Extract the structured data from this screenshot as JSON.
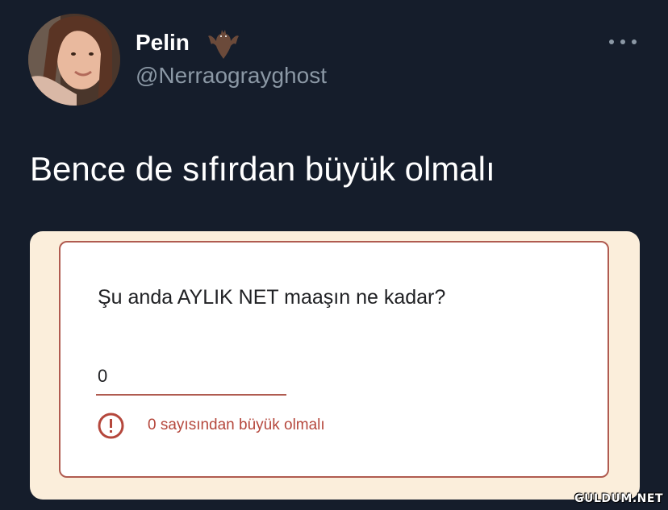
{
  "tweet": {
    "author": {
      "display_name": "Pelin",
      "username": "@Nerraograyghost",
      "avatar_icon": "profile-photo",
      "name_emoji": "bat-icon"
    },
    "more_icon": "more-horizontal-icon",
    "text": "Bence de sıfırdan büyük olmalı"
  },
  "form": {
    "question": "Şu anda AYLIK NET maaşın ne kadar?",
    "answer_value": "0",
    "error_icon": "error-circle-icon",
    "error_message": "0 sayısından büyük olmalı",
    "colors": {
      "error": "#b5473c",
      "border": "#b05b50"
    }
  },
  "watermark": "GULDUM.NET",
  "colors": {
    "background": "#151d2b",
    "card_background": "#fbeedb",
    "secondary_text": "#8b98a5"
  }
}
